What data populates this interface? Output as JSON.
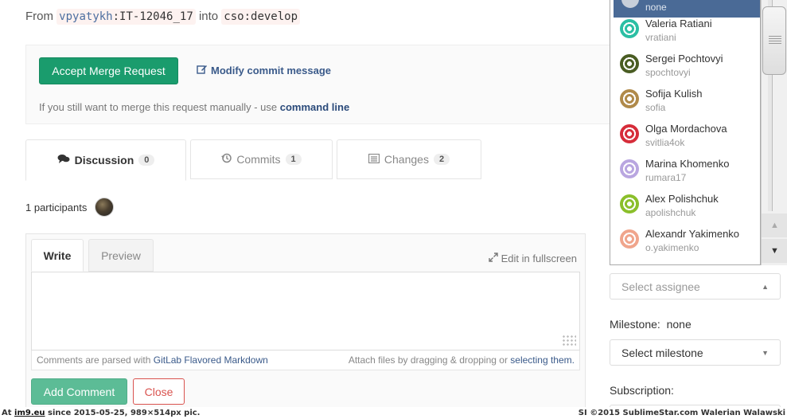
{
  "merge_header": {
    "from_label": "From",
    "source_user": "vpyatykh",
    "source_branch": ":IT-12046_17",
    "into_label": "into",
    "target_branch": "cso:develop"
  },
  "merge_box": {
    "accept_button": "Accept Merge Request",
    "modify_link": "Modify commit message",
    "manual_text": "If you still want to merge this request manually - use",
    "command_line_link": "command line"
  },
  "tabs": [
    {
      "label": "Discussion",
      "count": "0",
      "icon": "comments-icon",
      "active": true
    },
    {
      "label": "Commits",
      "count": "1",
      "icon": "history-icon",
      "active": false
    },
    {
      "label": "Changes",
      "count": "2",
      "icon": "list-alt-icon",
      "active": false
    }
  ],
  "participants": {
    "text": "1 participants"
  },
  "comment_form": {
    "write_tab": "Write",
    "preview_tab": "Preview",
    "fullscreen_link": "Edit in fullscreen",
    "markdown_prefix": "Comments are parsed with",
    "markdown_link": "GitLab Flavored Markdown",
    "attach_prefix": "Attach files by dragging & dropping or",
    "attach_link": "selecting them.",
    "add_button": "Add Comment",
    "close_button": "Close"
  },
  "sidebar": {
    "assignee_placeholder": "Select assignee",
    "milestone_label": "Milestone:",
    "milestone_value": "none",
    "milestone_select": "Select milestone",
    "subscription_label": "Subscription:"
  },
  "assignee_dropdown": {
    "highlighted_username": "none",
    "users": [
      {
        "name": "Valeria Ratiani",
        "username": "vratiani",
        "color": "#2bbfa4"
      },
      {
        "name": "Sergei Pochtovyi",
        "username": "spochtovyi",
        "color": "#4a5d23"
      },
      {
        "name": "Sofija Kulish",
        "username": "sofia",
        "color": "#b08a4a"
      },
      {
        "name": "Olga Mordachova",
        "username": "svitlia4ok",
        "color": "#d62d3a"
      },
      {
        "name": "Marina Khomenko",
        "username": "rumara17",
        "color": "#b9a6e0"
      },
      {
        "name": "Alex Polishchuk",
        "username": "apolishchuk",
        "color": "#8bbf2b"
      },
      {
        "name": "Alexandr Yakimenko",
        "username": "o.yakimenko",
        "color": "#f0a58c"
      }
    ]
  },
  "footer": {
    "left_prefix": "At",
    "left_site": "im9.eu",
    "left_suffix": "since 2015-05-25, 989×514px pic.",
    "right": "SI ©2015 SublimeStar.com Walerian Walawski"
  }
}
